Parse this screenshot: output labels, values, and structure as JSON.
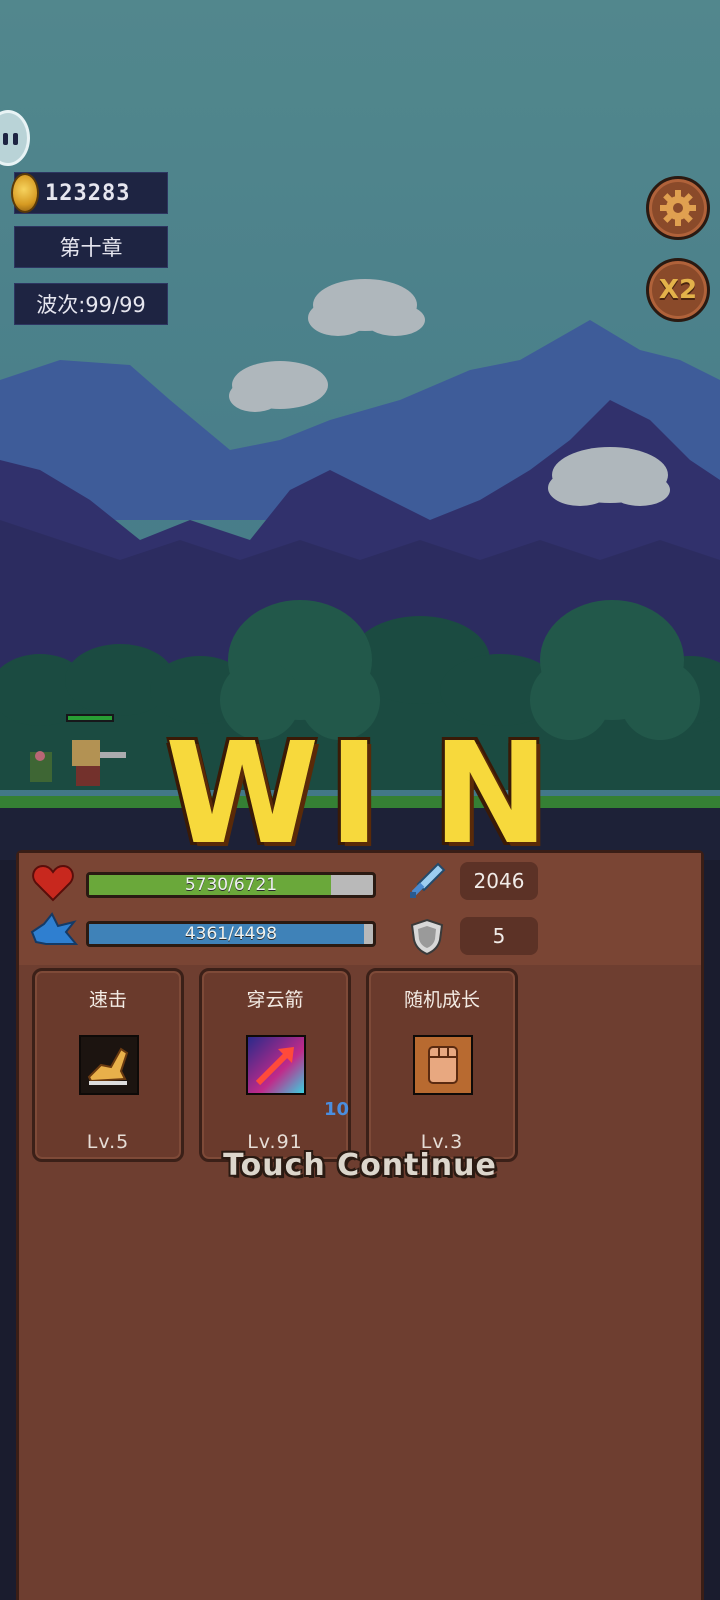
{
  "hud": {
    "coins": "123283",
    "chapter": "第十章",
    "wave": "波次:99/99"
  },
  "buttons": {
    "speed_label": "X2"
  },
  "stats": {
    "hp": {
      "text": "5730/6721",
      "current": 5730,
      "max": 6721
    },
    "mp": {
      "text": "4361/4498",
      "current": 4361,
      "max": 4498
    },
    "attack": "2046",
    "defense": "5"
  },
  "skills": [
    {
      "name": "速击",
      "level": "Lv.5",
      "count": ""
    },
    {
      "name": "穿云箭",
      "level": "Lv.91",
      "count": "10"
    },
    {
      "name": "随机成长",
      "level": "Lv.3",
      "count": ""
    }
  ],
  "banner": {
    "win_letters": [
      "W",
      "I",
      "N"
    ],
    "continue_text": "Touch Continue"
  },
  "colors": {
    "hp_fill": "#6aa83a",
    "mp_fill": "#3f82b8",
    "win_gold": "#f7d93c"
  }
}
